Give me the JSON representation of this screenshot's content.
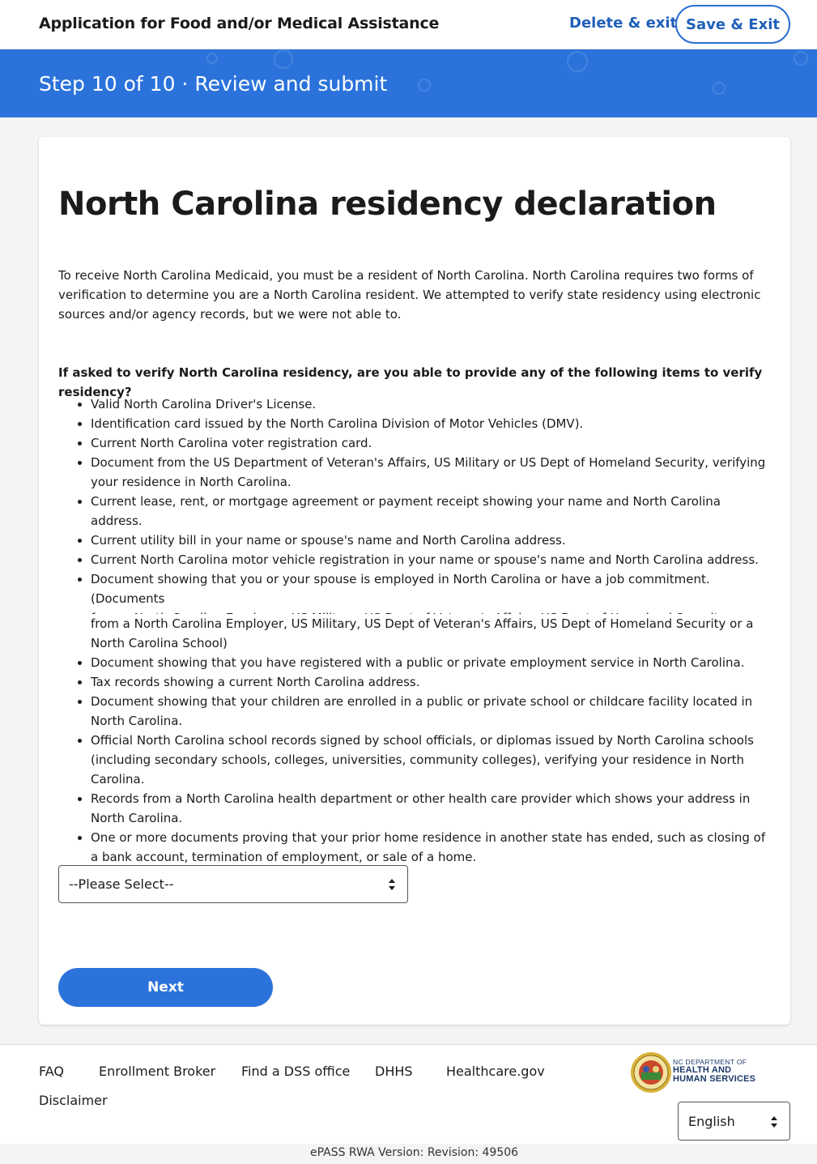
{
  "header": {
    "app_title": "Application for Food and/or Medical Assistance",
    "delete_exit": "Delete & exit",
    "save_exit": "Save & Exit"
  },
  "banner": {
    "step": "Step 10 of 10 · Review and submit"
  },
  "main": {
    "title": "North Carolina residency declaration",
    "intro": "To receive North Carolina Medicaid, you must be a resident of North Carolina. North Carolina requires two forms of verification to determine you are a North Carolina resident. We attempted to verify state residency using electronic sources and/or agency records, but we were not able to.",
    "question": "If asked to verify North Carolina residency, are you able to provide any of the following items to verify residency?",
    "items": [
      "Valid North Carolina Driver's License.",
      "Identification card issued by the North Carolina Division of Motor Vehicles (DMV).",
      "Current North Carolina voter registration card.",
      "Document from the US Department of Veteran's Affairs, US Military or US Dept of Homeland Security, verifying your residence in North Carolina.",
      "Current lease, rent, or mortgage agreement or payment receipt showing your name and North Carolina address.",
      "Current utility bill in your name or spouse's name and North Carolina address.",
      "Current North Carolina motor vehicle registration in your name or spouse's name and North Carolina address.",
      "Document showing that you or your spouse is employed in North Carolina or have a job commitment. (Documents",
      "from a North Carolina Employer, US Military, US Dept of Veteran's Affairs, US Dept of Homeland Security or a North Carolina School)",
      "Document showing that you have registered with a public or private employment service in North Carolina.",
      "Tax records showing a current North Carolina address.",
      "Document showing that your children are enrolled in a public or private school or childcare facility located in North Carolina.",
      "Official North Carolina school records signed by school officials, or diplomas issued by North Carolina schools (including secondary schools, colleges, universities, community colleges), verifying your residence in North Carolina.",
      "Records from a North Carolina health department or other health care provider which shows your address in North Carolina.",
      "One or more documents proving that your prior home residence in another state has ended, such as closing of a bank account, termination of employment, or sale of a home."
    ],
    "select_value": "--Please Select--",
    "next_label": "Next"
  },
  "footer": {
    "links": [
      "FAQ",
      "Enrollment Broker",
      "Find a DSS office",
      "DHHS",
      "Healthcare.gov",
      "Disclaimer"
    ],
    "logo_line1": "NC DEPARTMENT OF",
    "logo_line2": "HEALTH AND",
    "logo_line3": "HUMAN SERVICES",
    "language": "English",
    "version": "ePASS RWA Version: Revision: 49506"
  },
  "colors": {
    "brand_blue": "#2b73db",
    "link_blue": "#1f5fb9"
  }
}
